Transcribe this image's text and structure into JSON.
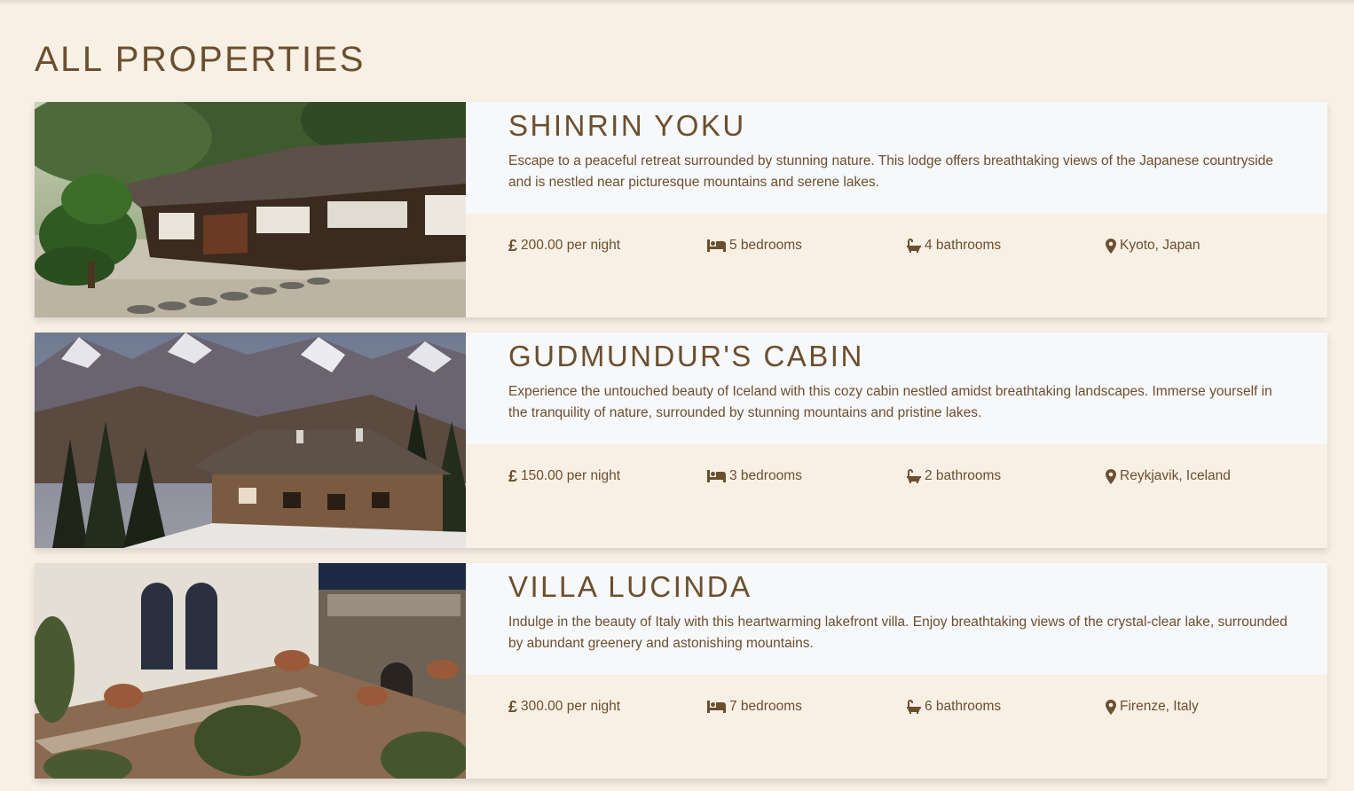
{
  "page": {
    "title": "ALL PROPERTIES"
  },
  "properties": [
    {
      "name": "SHINRIN YOKU",
      "description": "Escape to a peaceful retreat surrounded by stunning nature. This lodge offers breathtaking views of the Japanese countryside and is nestled near picturesque mountains and serene lakes.",
      "currency_symbol": "£",
      "price": "200.00 per night",
      "bedrooms": "5 bedrooms",
      "bathrooms": "4 bathrooms",
      "location": "Kyoto, Japan"
    },
    {
      "name": "GUDMUNDUR'S CABIN",
      "description": "Experience the untouched beauty of Iceland with this cozy cabin nestled amidst breathtaking landscapes. Immerse yourself in the tranquility of nature, surrounded by stunning mountains and pristine lakes.",
      "currency_symbol": "£",
      "price": "150.00 per night",
      "bedrooms": "3 bedrooms",
      "bathrooms": "2 bathrooms",
      "location": "Reykjavik, Iceland"
    },
    {
      "name": "VILLA LUCINDA",
      "description": "Indulge in the beauty of Italy with this heartwarming lakefront villa. Enjoy breathtaking views of the crystal-clear lake, surrounded by abundant greenery and astonishing mountains.",
      "currency_symbol": "£",
      "price": "300.00 per night",
      "bedrooms": "7 bedrooms",
      "bathrooms": "6 bathrooms",
      "location": "Firenze, Italy"
    }
  ],
  "icons": {
    "price": "pound-icon",
    "bedrooms": "bed-icon",
    "bathrooms": "bath-icon",
    "location": "map-marker-icon"
  },
  "colors": {
    "background": "#f8f0e5",
    "card_top": "#f7f8fa",
    "text": "#6b4f2e"
  }
}
